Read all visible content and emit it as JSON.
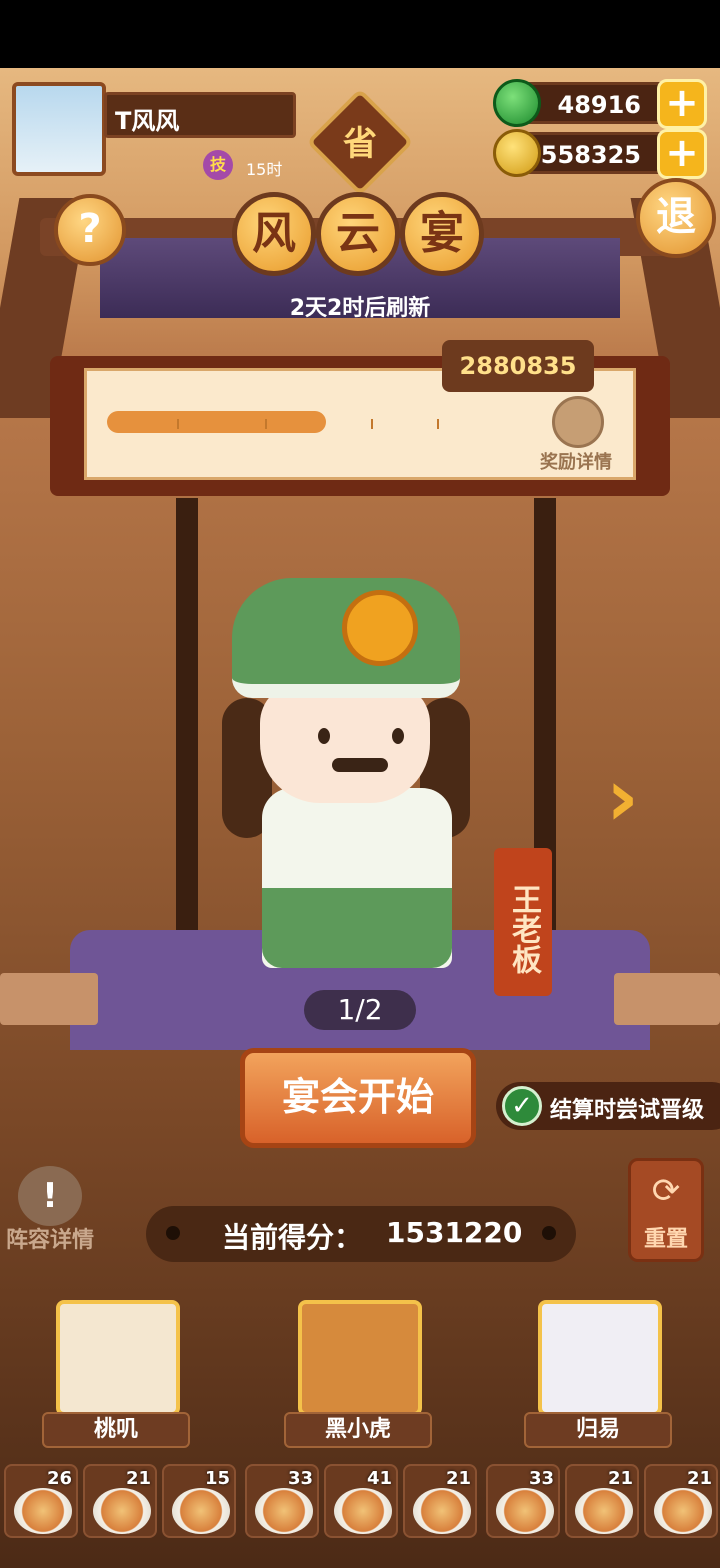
{
  "player": {
    "name": "T风风",
    "skill_badge": "技",
    "skill_hours": "15时"
  },
  "province_badge": "省",
  "currency": {
    "gems": "48916",
    "coins": "558325",
    "plus": "+"
  },
  "buttons": {
    "help": "?",
    "exit": "退"
  },
  "event": {
    "title_chars": [
      "风",
      "云",
      "宴"
    ],
    "refresh": "2天2时后刷新"
  },
  "progress": {
    "target_score": "2880835",
    "reward_label": "奖励详情",
    "fill_fraction": 0.53
  },
  "character": {
    "name": "王老板",
    "next": "›",
    "page": "1/2"
  },
  "actions": {
    "start": "宴会开始",
    "promote_check": "✓",
    "promote_label": "结算时尝试晋级",
    "lineup_icon": "!",
    "lineup_label": "阵容详情",
    "reset_icon": "⟳",
    "reset_label": "重置"
  },
  "score": {
    "label": "当前得分：",
    "value": "1531220"
  },
  "chefs": [
    {
      "name": "桃叽",
      "color": "#f4e7d0"
    },
    {
      "name": "黑小虎",
      "color": "#d68a3c"
    },
    {
      "name": "归易",
      "color": "#f0eef4"
    }
  ],
  "dishes": [
    "26",
    "21",
    "15",
    "33",
    "41",
    "21",
    "33",
    "21",
    "21"
  ]
}
